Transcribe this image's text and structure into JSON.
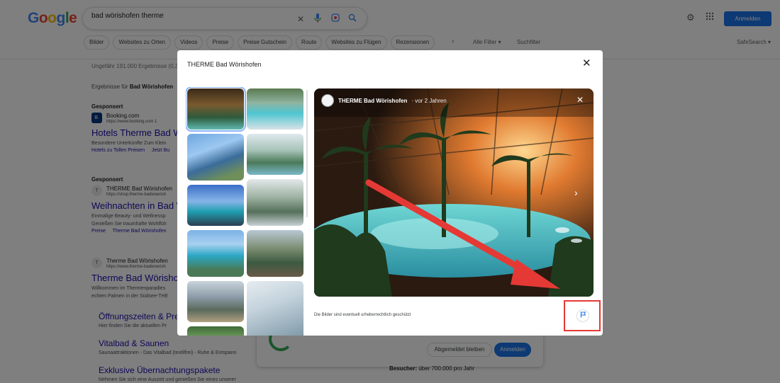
{
  "search": {
    "query": "bad wörishofen therme",
    "signin_label": "Anmelden",
    "chips": [
      "Bilder",
      "Websites zu Orten",
      "Videos",
      "Preise",
      "Preise Gutschein",
      "Route",
      "Websites zu Flügen",
      "Rezensionen"
    ],
    "all_filters": "Alle Filter",
    "search_filter": "Suchfilter",
    "safesearch": "SafeSearch",
    "stats": "Ungefähr 191.000 Ergebnisse (0,3",
    "results_for_prefix": "Ergebnisse für",
    "results_for_query": "Bad Wörishofen",
    "results": [
      {
        "sponsored": "Gesponsert",
        "site_name": "Booking.com",
        "site_url": "https://www.booking.com   1",
        "favicon": "B.",
        "title": "Hotels Therme Bad W",
        "description": "Besondere Unterkünfte Zum Klein",
        "links": [
          "Hotels zu Tollen Preisen",
          "Jetzt Bu"
        ]
      },
      {
        "sponsored": "Gesponsert",
        "site_name": "THERME Bad Wörishofen",
        "site_url": "https://shop.therme-badwoerish",
        "favicon": "T",
        "title": "Weihnachten in Bad W",
        "description_lines": [
          "Einmalige Beauty- und Wellnessp",
          "Genießen Sie traumhafte Wohlfüh"
        ],
        "links": [
          "Preise",
          "Therme Bad Wörishofen"
        ]
      },
      {
        "site_name": "Therme Bad Wörishofen",
        "site_url": "https://www.therme-badwoerish",
        "favicon": "T",
        "title": "Therme Bad Wörishof",
        "description_lines": [
          "Willkommen im Thermenparadies",
          "echten Palmen in der Südsee-THE"
        ]
      }
    ],
    "sublinks": [
      {
        "title": "Öffnungszeiten & Pre",
        "desc": "Hier finden Sie die aktuellen Pr"
      },
      {
        "title": "Vitalbad & Saunen",
        "desc": "Saunaattraktionen - Das Vitalbad (textilfrei) - Ruhe & Entspann"
      },
      {
        "title": "Exklusive Übernachtungspakete",
        "desc": "Nehmen Sie sich eine Auszeit und genießen Sie eines unserer"
      }
    ],
    "signin_card": {
      "stay_label": "Abgemeldet bleiben",
      "login_label": "Anmelden"
    },
    "visitors_label": "Besucher:",
    "visitors_value": "über 700.000 pro Jahr"
  },
  "modal": {
    "title": "THERME Bad Wörishofen",
    "viewer": {
      "author": "THERME Bad Wörishofen",
      "time": "· vor 2 Jahren"
    },
    "copyright": "Die Bilder sind eventuell urheberrechtlich geschützt",
    "thumbnails": [
      "palm-hall-night",
      "outdoor-pool-aerial",
      "glass-building",
      "glass-dome-interior",
      "lagoon-pool-dusk",
      "palm-atrium",
      "pool-aerial-blue",
      "restaurant-terrace",
      "glass-corridor",
      "glass-roof-hall",
      "palm-garden",
      "palm-sky"
    ]
  },
  "colors": {
    "link": "#1a0dab",
    "accent": "#1a73e8",
    "annotation": "#e53935"
  }
}
